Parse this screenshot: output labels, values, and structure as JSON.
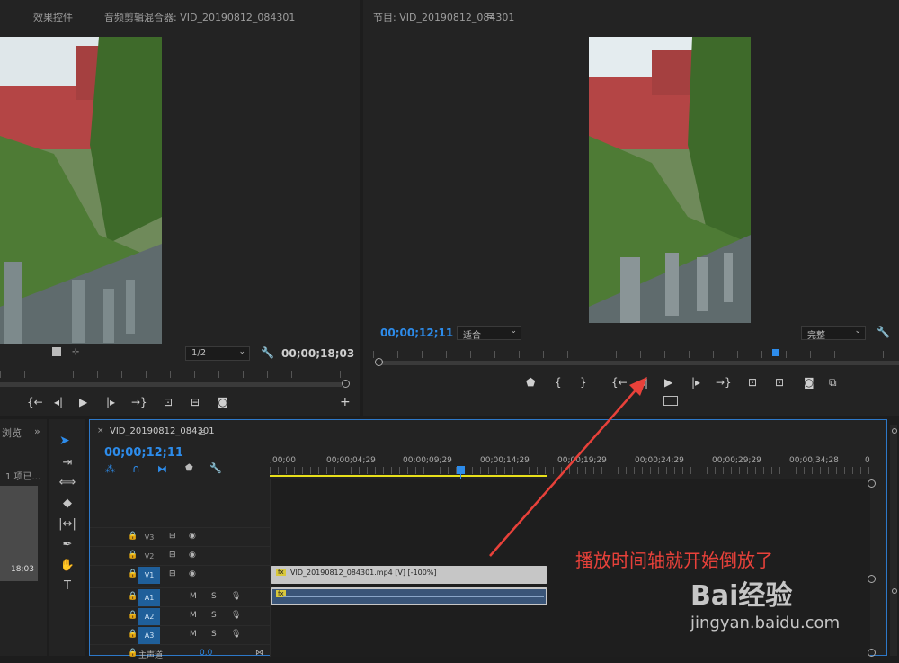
{
  "source": {
    "tab_effects": "效果控件",
    "tab_mixer": "音频剪辑混合器: VID_20190812_084301",
    "scale": "1/2",
    "timecode": "00;00;18;03"
  },
  "program": {
    "title": "节目: VID_20190812_084301",
    "timecode": "00;00;12;11",
    "fit": "适合",
    "quality": "完整"
  },
  "project": {
    "tab": "浏览",
    "items": "1 项已...",
    "thumb_duration": "18;03"
  },
  "timeline": {
    "tab": "VID_20190812_084301",
    "timecode": "00;00;12;11",
    "ruler": [
      ";00;00",
      "00;00;04;29",
      "00;00;09;29",
      "00;00;14;29",
      "00;00;19;29",
      "00;00;24;29",
      "00;00;29;29",
      "00;00;34;28",
      "0"
    ],
    "video_tracks": [
      {
        "label": "V3",
        "on": false
      },
      {
        "label": "V2",
        "on": false
      },
      {
        "label": "V1",
        "on": true
      }
    ],
    "audio_tracks": [
      {
        "label": "A1",
        "on": true,
        "m": "M",
        "s": "S"
      },
      {
        "label": "A2",
        "on": true,
        "m": "M",
        "s": "S"
      },
      {
        "label": "A3",
        "on": true,
        "m": "M",
        "s": "S"
      }
    ],
    "master_label": "主声道",
    "master_value": "0.0",
    "clip_label": "VID_20190812_084301.mp4 [V] [-100%]",
    "clip_fx": "fx",
    "audio_fx": "fx"
  },
  "annotation": {
    "text": "播放时间轴就开始倒放了",
    "color": "#e8413a"
  },
  "watermark": {
    "brand": "Bai经验",
    "url": "jingyan.baidu.com"
  },
  "colors": {
    "accent": "#2d8ceb",
    "yellow": "#e8e01b",
    "clip": "#c6c6c6",
    "audio": "#3a5578"
  }
}
